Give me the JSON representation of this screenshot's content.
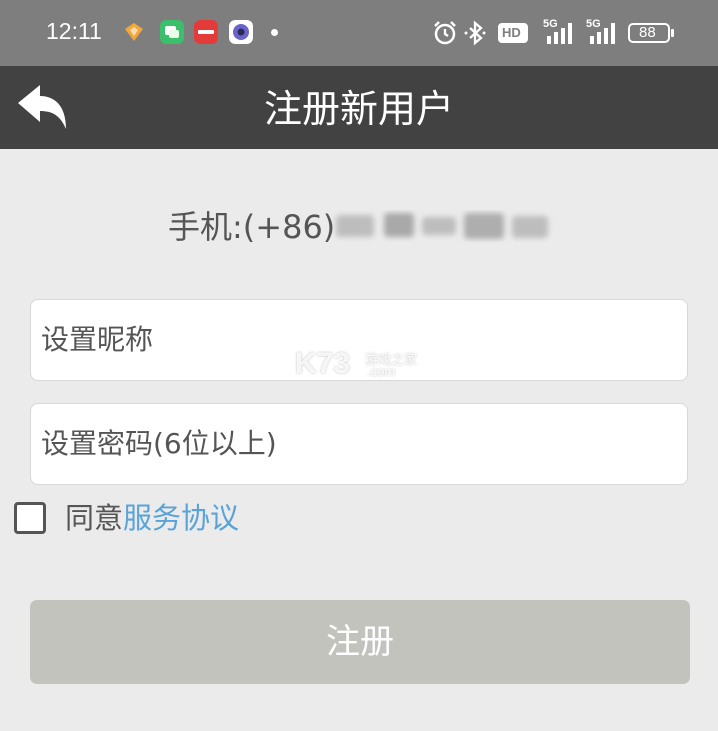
{
  "status_bar": {
    "time": "12:11",
    "hd_label": "HD",
    "network_1": "5G",
    "network_2": "5G",
    "battery": "88"
  },
  "header": {
    "title": "注册新用户",
    "back_icon": "back-arrow-icon"
  },
  "phone": {
    "label": "手机:(+86)"
  },
  "form": {
    "nickname_placeholder": "设置昵称",
    "password_placeholder": "设置密码(6位以上)"
  },
  "agreement": {
    "checked": false,
    "text": "同意",
    "link": "服务协议"
  },
  "submit_label": "注册",
  "watermark": {
    "brand": "K73",
    "sub": "游戏之家",
    "domain": ".com"
  },
  "colors": {
    "status_bar": "#7e7e7e",
    "title_bar": "#424242",
    "background": "#ebebeb",
    "link": "#5aa3d8",
    "button_disabled": "#c2c3bd"
  }
}
